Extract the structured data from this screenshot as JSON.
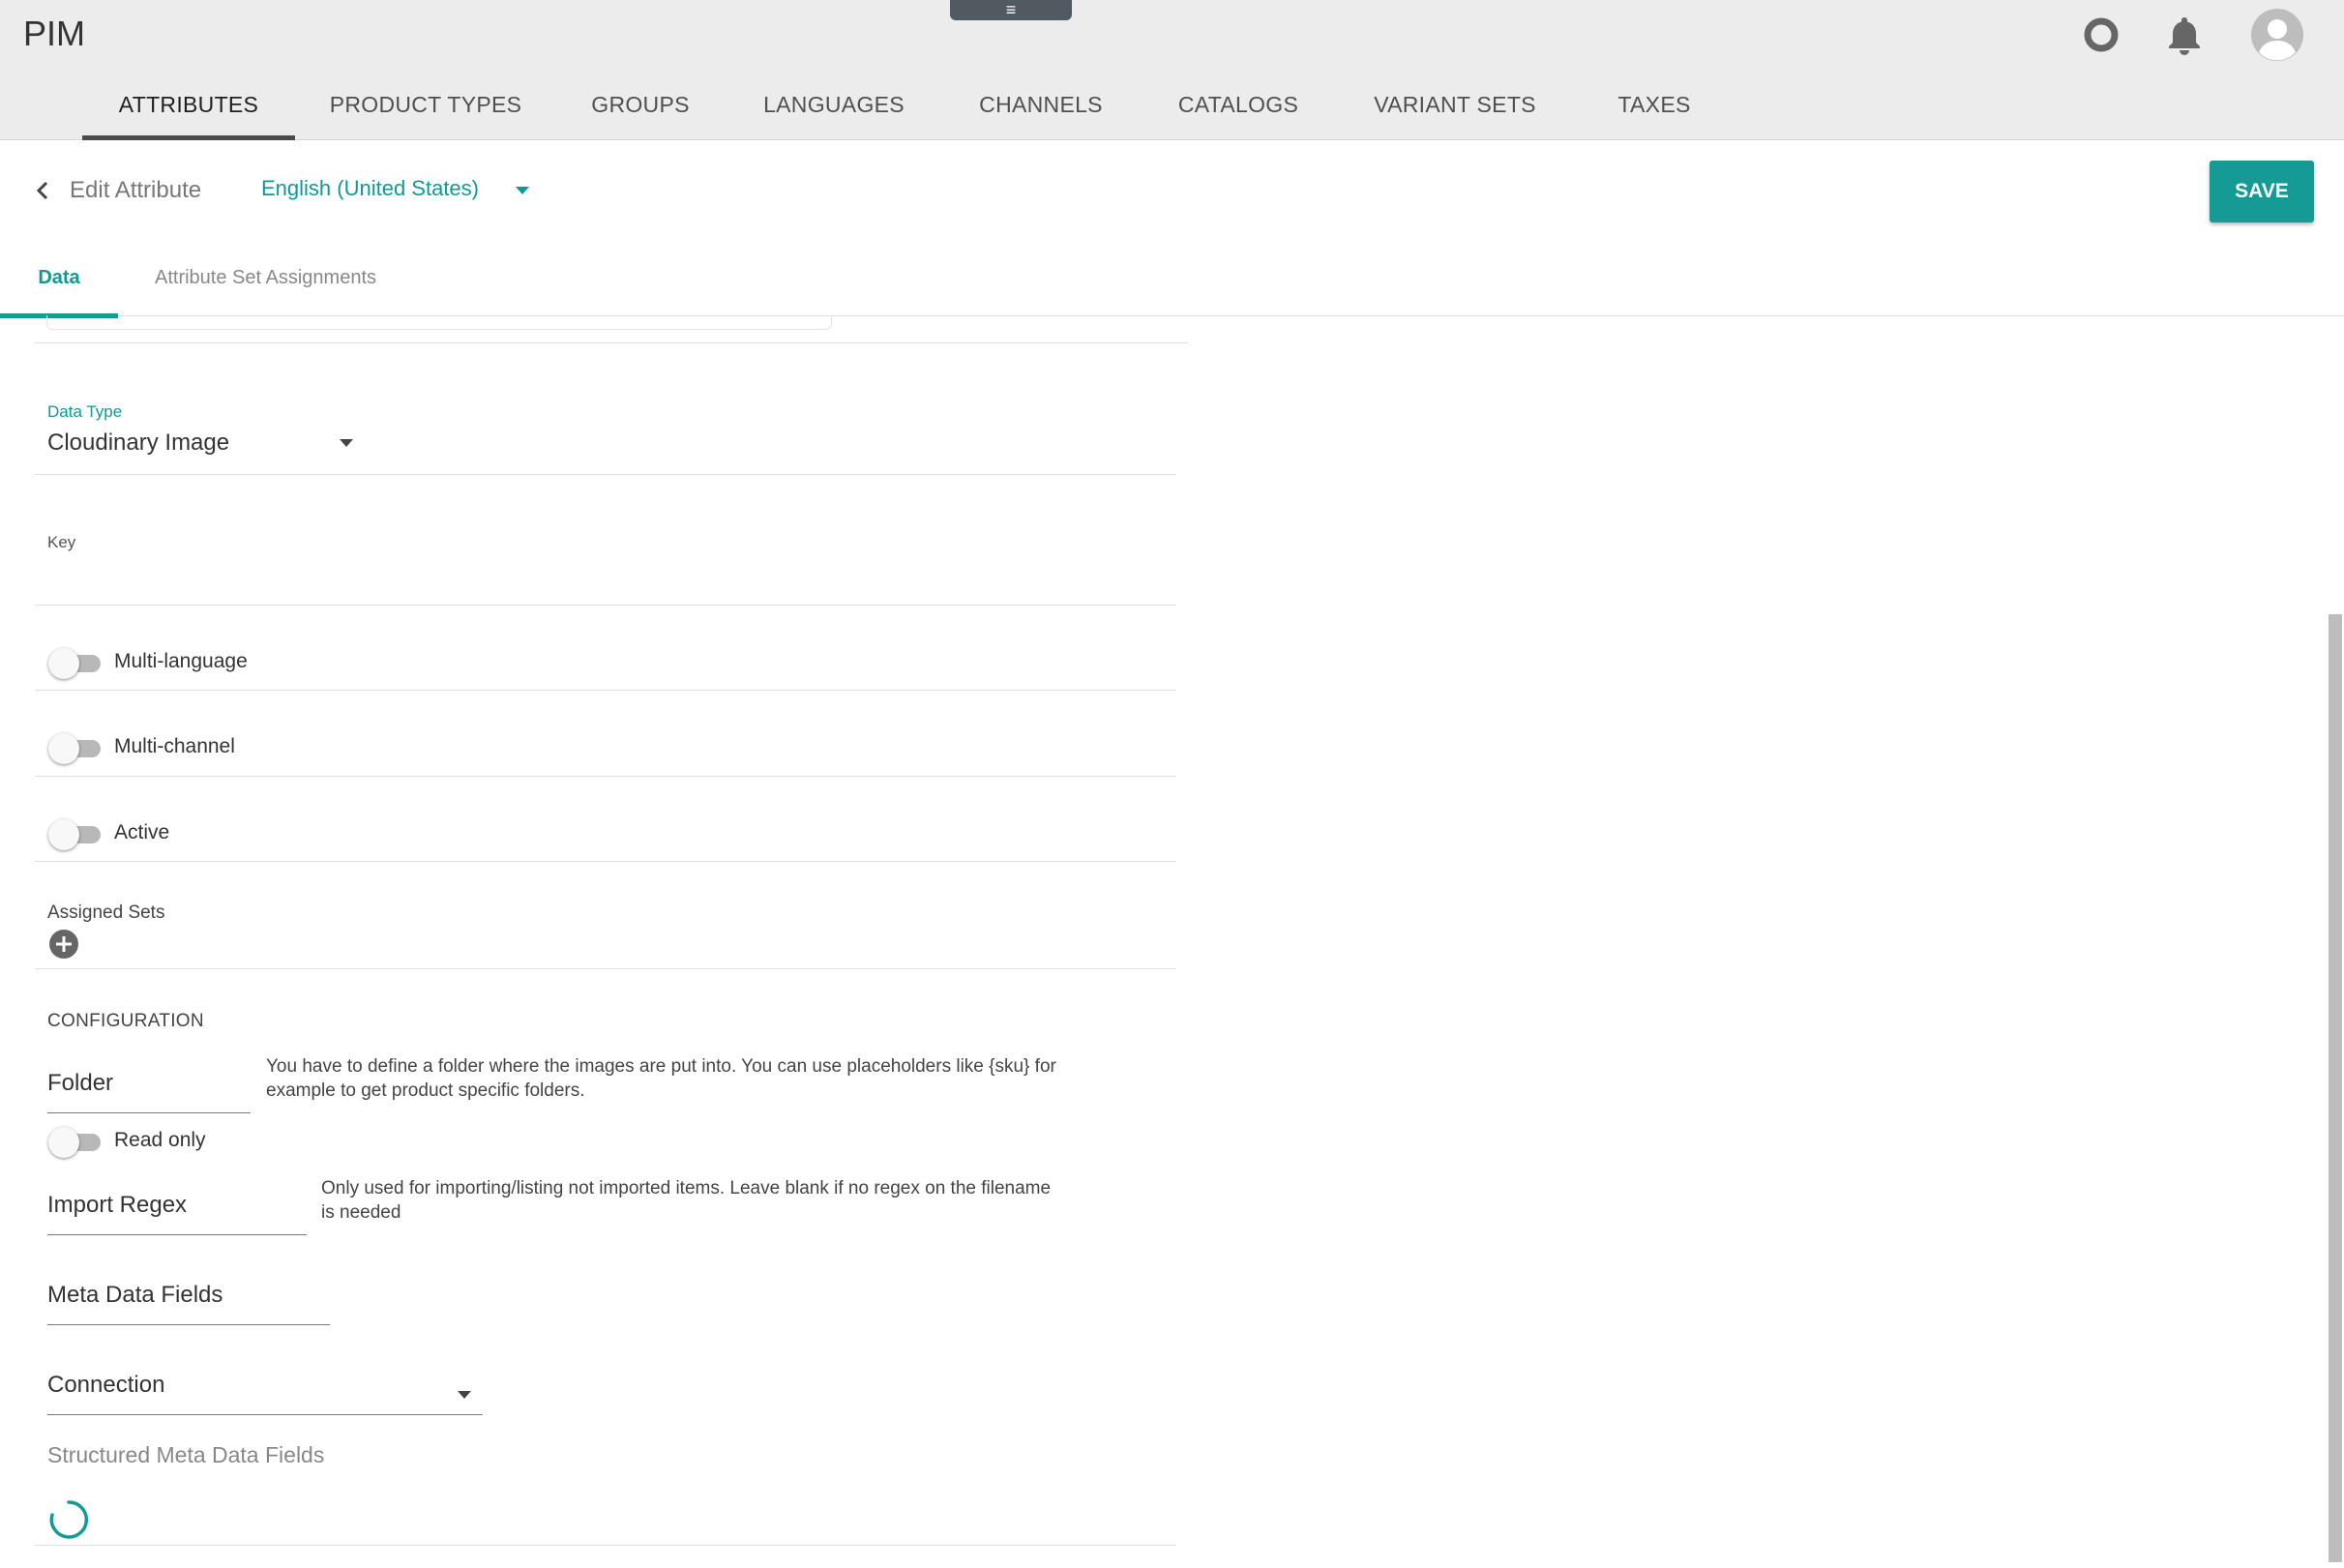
{
  "app": {
    "title": "PIM",
    "handle_icon": "≡"
  },
  "header_icons": [
    "help-ring-icon",
    "bell-icon",
    "avatar-icon"
  ],
  "main_nav": {
    "tabs": [
      {
        "label": "ATTRIBUTES",
        "active": true
      },
      {
        "label": "PRODUCT TYPES"
      },
      {
        "label": "GROUPS"
      },
      {
        "label": "LANGUAGES"
      },
      {
        "label": "CHANNELS"
      },
      {
        "label": "CATALOGS"
      },
      {
        "label": "VARIANT SETS"
      },
      {
        "label": "TAXES"
      }
    ]
  },
  "subheader": {
    "title": "Edit Attribute",
    "language": "English (United States)",
    "save_label": "SAVE"
  },
  "sub_tabs": [
    {
      "label": "Data",
      "active": true
    },
    {
      "label": "Attribute Set Assignments"
    }
  ],
  "form": {
    "data_type": {
      "label": "Data Type",
      "value": "Cloudinary Image"
    },
    "key": {
      "label": "Key",
      "value": ""
    },
    "toggles": {
      "multi_language": {
        "label": "Multi-language",
        "on": false
      },
      "multi_channel": {
        "label": "Multi-channel",
        "on": false
      },
      "active": {
        "label": "Active",
        "on": false
      }
    },
    "assigned_sets": {
      "label": "Assigned Sets"
    }
  },
  "configuration": {
    "title": "CONFIGURATION",
    "folder": {
      "placeholder": "Folder",
      "hint_line1": "You have to define a folder where the images are put into. You can use placeholders like {sku} for",
      "hint_line2": "example to get product specific folders."
    },
    "read_only": {
      "label": "Read only",
      "on": false
    },
    "import_regex": {
      "placeholder": "Import Regex",
      "hint_line1": "Only used for importing/listing not imported items. Leave blank if no regex on the filename",
      "hint_line2": "is needed"
    },
    "meta_data_fields": {
      "placeholder": "Meta Data Fields"
    },
    "connection": {
      "placeholder": "Connection"
    },
    "structured_meta": {
      "label": "Structured Meta Data Fields"
    }
  },
  "colors": {
    "accent": "#169a96",
    "header_bg": "#ececec"
  }
}
